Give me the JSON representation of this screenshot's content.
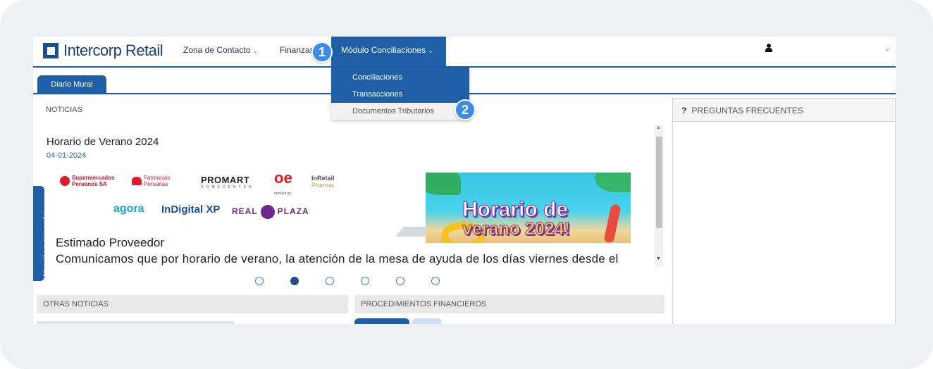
{
  "brand": {
    "name": "Intercorp Retail"
  },
  "nav": {
    "items": [
      {
        "label": "Zona de Contacto"
      },
      {
        "label": "Finanzas"
      },
      {
        "label": "Módulo Conciliaciones"
      }
    ]
  },
  "dropdown": {
    "items": [
      {
        "label": "Conciliaciones"
      },
      {
        "label": "Transacciones"
      },
      {
        "label": "Documentos Tributarios"
      }
    ]
  },
  "badges": {
    "one": "1",
    "two": "2"
  },
  "tabs": {
    "active": "Diario Mural"
  },
  "noticias": {
    "section_label": "NOTICIAS",
    "title": "Horario de Verano 2024",
    "date": "04-01-2024",
    "brands": {
      "supermercados_1": "Supermercados",
      "supermercados_2": "Peruanos",
      "supermercados_3": "SA",
      "farmacias_1": "Farmacias",
      "farmacias_2": "Peruanas",
      "promart": "PROMART",
      "promart_sub": "HOMECENTER",
      "oe": "oe",
      "oe_sub": "oechsle.pe",
      "inretail": "InRetail",
      "inretail_sub": "Pharma",
      "agora": "agora",
      "indigital": "InDigital XP",
      "real": "REAL",
      "plaza": "PLAZA"
    },
    "banner": {
      "line1": "Horario de",
      "line2": "verano 2024!"
    },
    "greeting": "Estimado Proveedor",
    "message": "Comunicamos que por horario de verano, la atención de la mesa de ayuda de los días viernes desde el"
  },
  "side_tab": {
    "label": "Atención a proveedor"
  },
  "carousel": {
    "count": 6,
    "active_index": 1
  },
  "sections": {
    "otras": "OTRAS NOTICIAS",
    "procedimientos": "PROCEDIMIENTOS FINANCIEROS",
    "faq": "PREGUNTAS FRECUENTES",
    "faq_icon": "?"
  },
  "colors": {
    "primary": "#1e5fa8",
    "badge": "#3b8de6"
  }
}
